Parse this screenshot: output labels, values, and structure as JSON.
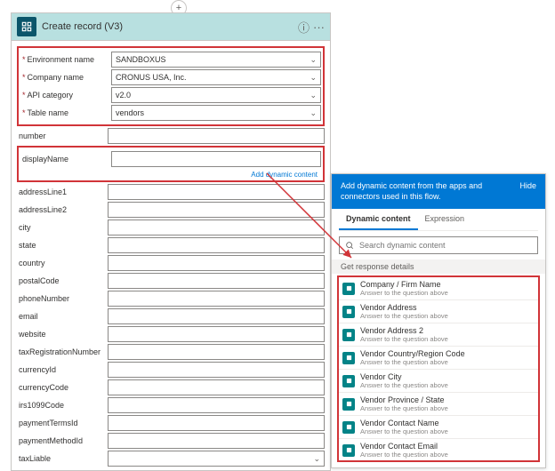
{
  "action_title": "Create record (V3)",
  "fields": {
    "env": {
      "label": "Environment name",
      "value": "SANDBOXUS"
    },
    "company": {
      "label": "Company name",
      "value": "CRONUS USA, Inc."
    },
    "api": {
      "label": "API category",
      "value": "v2.0"
    },
    "table": {
      "label": "Table name",
      "value": "vendors"
    }
  },
  "simple": {
    "number": "number",
    "displayName": "displayName",
    "addressLine1": "addressLine1",
    "addressLine2": "addressLine2",
    "city": "city",
    "state": "state",
    "country": "country",
    "postalCode": "postalCode",
    "phoneNumber": "phoneNumber",
    "email": "email",
    "website": "website",
    "taxRegistrationNumber": "taxRegistrationNumber",
    "currencyId": "currencyId",
    "currencyCode": "currencyCode",
    "irs1099Code": "irs1099Code",
    "paymentTermsId": "paymentTermsId",
    "paymentMethodId": "paymentMethodId",
    "taxLiable": "taxLiable"
  },
  "add_label": "Add dynamic content",
  "dyn": {
    "header": "Add dynamic content from the apps and connectors used in this flow.",
    "hide": "Hide",
    "tab_dc": "Dynamic content",
    "tab_ex": "Expression",
    "search_ph": "Search dynamic content",
    "group": "Get response details",
    "items": {
      "i0": {
        "t": "Company / Firm Name",
        "s": "Answer to the question above"
      },
      "i1": {
        "t": "Vendor Address",
        "s": "Answer to the question above"
      },
      "i2": {
        "t": "Vendor Address 2",
        "s": "Answer to the question above"
      },
      "i3": {
        "t": "Vendor Country/Region Code",
        "s": "Answer to the question above"
      },
      "i4": {
        "t": "Vendor City",
        "s": "Answer to the question above"
      },
      "i5": {
        "t": "Vendor Province / State",
        "s": "Answer to the question above"
      },
      "i6": {
        "t": "Vendor Contact Name",
        "s": "Answer to the question above"
      },
      "i7": {
        "t": "Vendor Contact Email",
        "s": "Answer to the question above"
      }
    }
  }
}
